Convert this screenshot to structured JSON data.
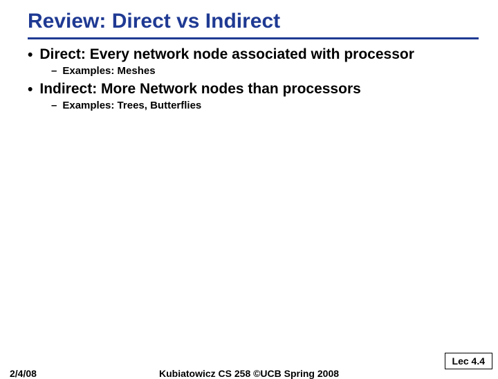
{
  "title": "Review: Direct vs Indirect",
  "bullets": [
    {
      "level": 1,
      "text": "Direct: Every network node associated with processor"
    },
    {
      "level": 2,
      "text": "Examples: Meshes"
    },
    {
      "level": 1,
      "text": "Indirect: More Network nodes than processors"
    },
    {
      "level": 2,
      "text": "Examples: Trees, Butterflies"
    }
  ],
  "footer": {
    "left": "2/4/08",
    "center": "Kubiatowicz CS 258 ©UCB Spring 2008",
    "right": "Lec 4.4"
  }
}
